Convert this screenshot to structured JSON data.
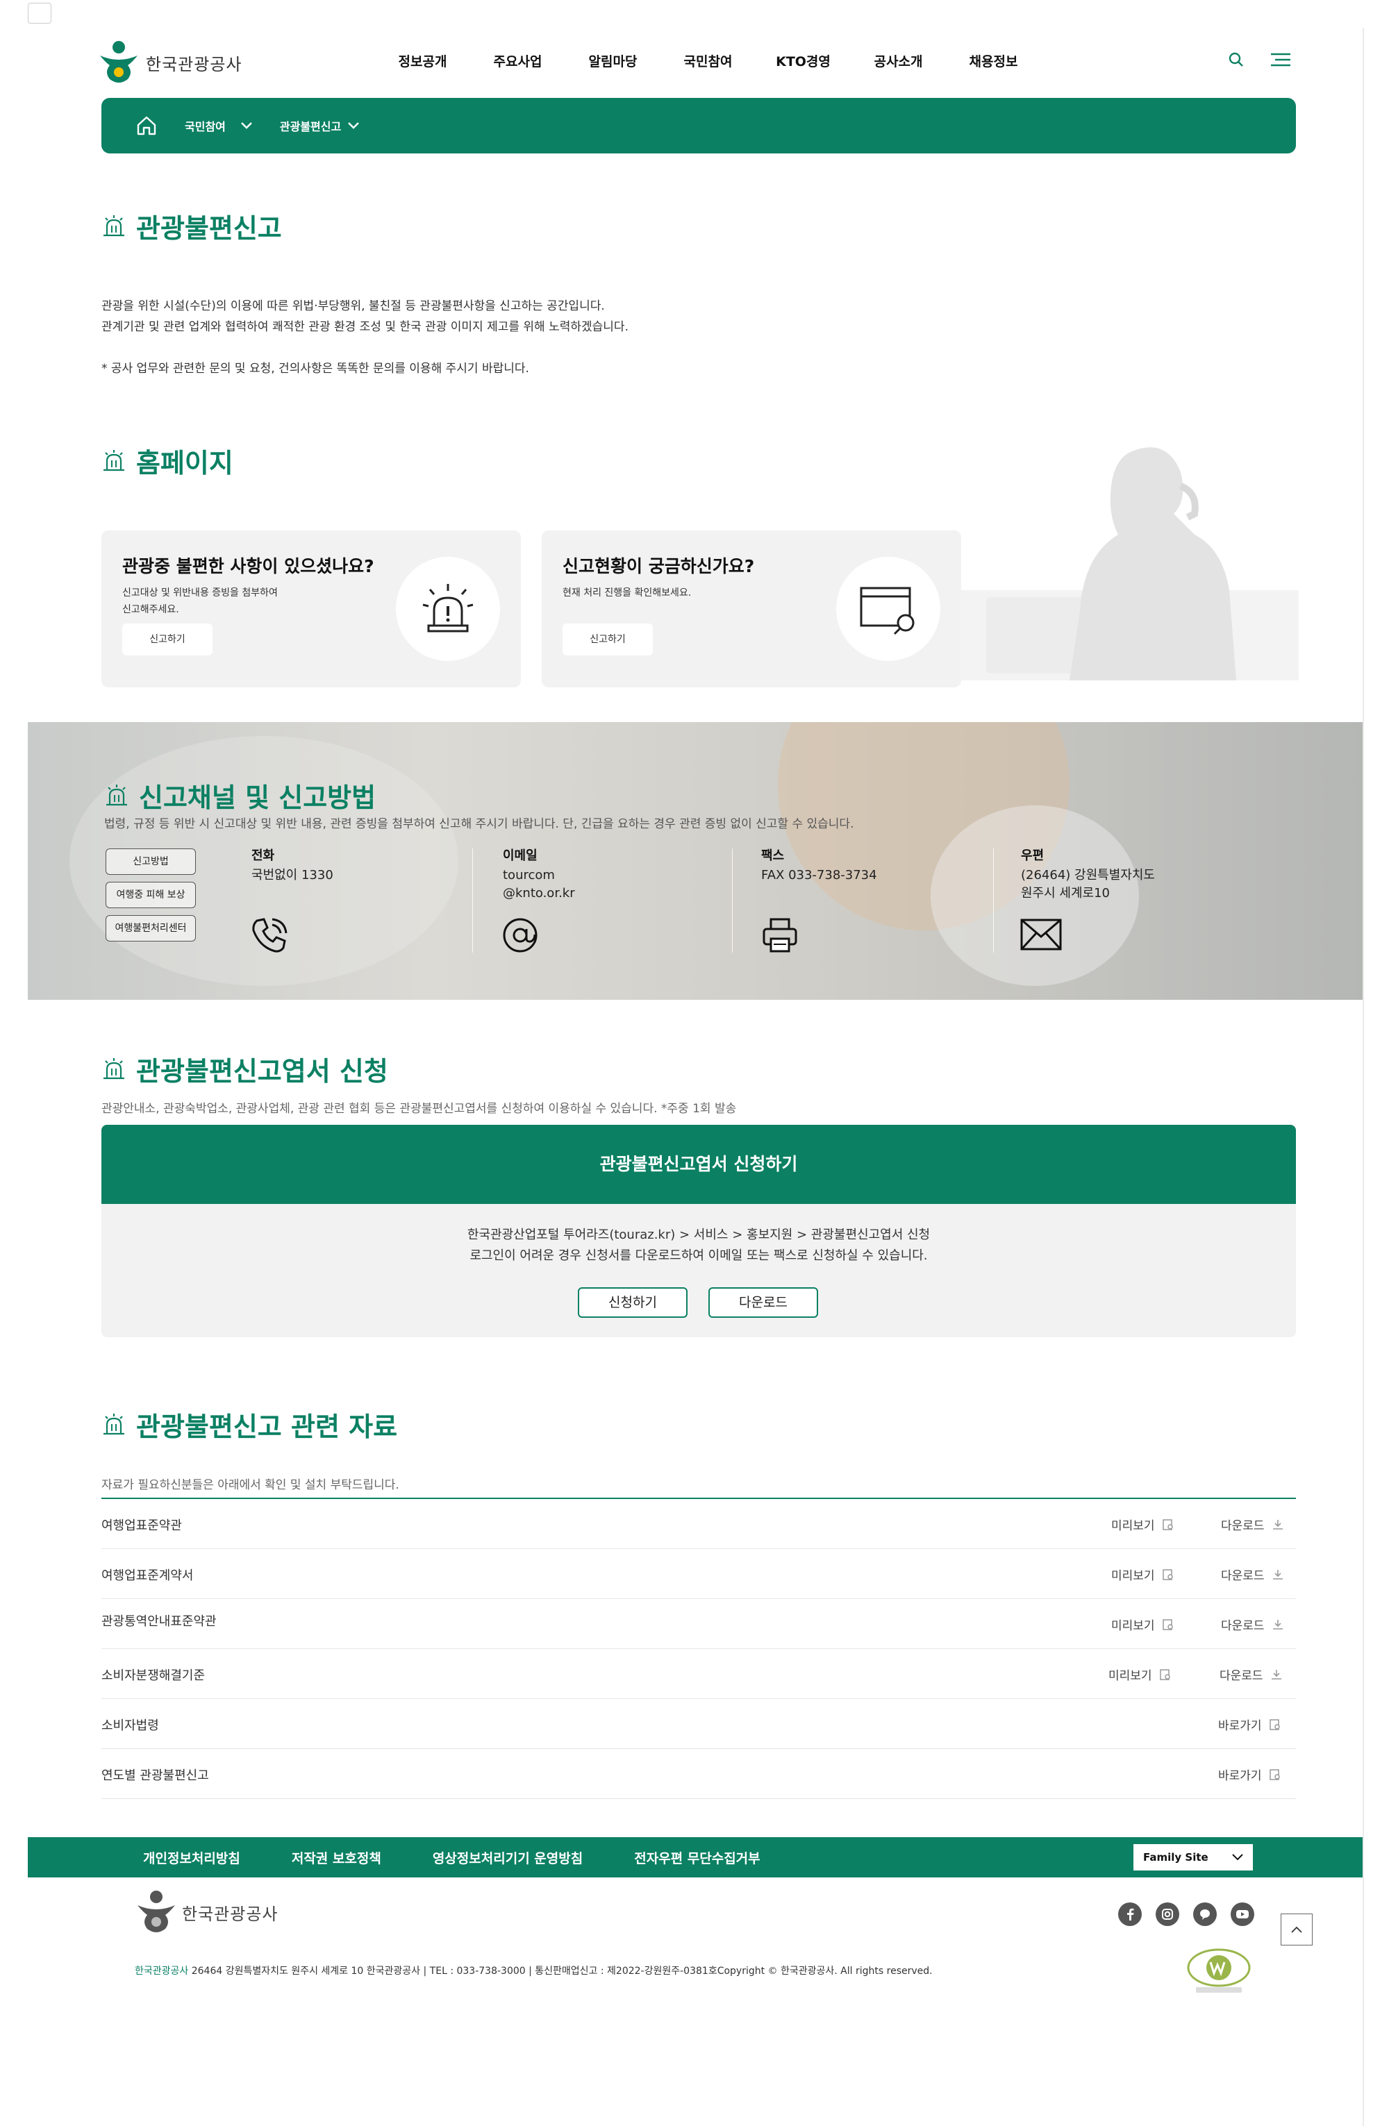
{
  "header": {
    "logo_text": "한국관광공사",
    "nav": [
      "정보공개",
      "주요사업",
      "알림마당",
      "국민참여",
      "KTO경영",
      "공사소개",
      "채용정보"
    ]
  },
  "breadcrumb": {
    "level1": "국민참여",
    "level2": "관광불편신고"
  },
  "intro": {
    "title": "관광불편신고",
    "line1": "관광을 위한 시설(수단)의 이용에 따른 위법·부당행위, 불친절 등 관광불편사항을 신고하는 공간입니다.",
    "line2": "관계기관 및 관련 업계와 협력하여 쾌적한 관광 환경 조성 및 한국 관광 이미지 제고를 위해 노력하겠습니다.",
    "note": "* 공사 업무와 관련한 문의 및 요청, 건의사항은 똑똑한 문의를 이용해 주시기 바랍니다."
  },
  "homepage": {
    "title": "홈페이지",
    "card1": {
      "title": "관광중 불편한 사항이 있으셨나요?",
      "desc_line1": "신고대상 및 위반내용 증빙을 첨부하여",
      "desc_line2": "신고해주세요.",
      "button": "신고하기"
    },
    "card2": {
      "title": "신고현황이 궁금하신가요?",
      "desc_line1": "현재 처리 진행을 확인해보세요.",
      "button": "신고하기"
    }
  },
  "channels": {
    "title": "신고채널 및 신고방법",
    "desc": "법령, 규정 등 위반 시 신고대상 및 위반 내용, 관련 증빙을 첨부하여 신고해 주시기 바랍니다. 단, 긴급을 요하는 경우 관련 증빙 없이 신고할 수 있습니다.",
    "tabs": [
      "신고방법",
      "여행중 피해 보상",
      "여행불편처리센터"
    ],
    "phone": {
      "label": "전화",
      "value": "국번없이 1330"
    },
    "email": {
      "label": "이메일",
      "line1": "tourcom",
      "line2": "@knto.or.kr"
    },
    "fax": {
      "label": "팩스",
      "value": "FAX 033-738-3734"
    },
    "post": {
      "label": "우편",
      "line1": "(26464) 강원특별자치도",
      "line2": "원주시 세계로10"
    }
  },
  "apply": {
    "title": "관광불편신고엽서 신청",
    "desc": "관광안내소, 관광숙박업소, 관광사업체, 관광 관련 협회 등은 관광불편신고엽서를 신청하여 이용하실 수 있습니다. *주중 1회 발송",
    "box_title": "관광불편신고엽서 신청하기",
    "line1": "한국관광산업포털 투어라즈(touraz.kr) > 서비스 > 홍보지원 > 관광불편신고엽서 신청",
    "line2": "로그인이 어려운 경우 신청서를 다운로드하여 이메일 또는 팩스로 신청하실 수 있습니다.",
    "btn_apply": "신청하기",
    "btn_download": "다운로드"
  },
  "resources": {
    "title": "관광불편신고 관련 자료",
    "desc": "자료가 필요하신분들은 아래에서 확인 및 설치 부탁드립니다.",
    "preview": "미리보기",
    "download": "다운로드",
    "goto": "바로가기",
    "items": [
      "여행업표준약관",
      "여행업표준계약서",
      "관광통역안내표준약관",
      "소비자분쟁해결기준",
      "소비자법령",
      "연도별 관광불편신고"
    ]
  },
  "footer": {
    "links": [
      "개인정보처리방침",
      "저작권 보호정책",
      "영상정보처리기기 운영방침",
      "전자우편 무단수집거부"
    ],
    "family_site": "Family Site",
    "logo_text": "한국관광공사",
    "org": "한국관광공사",
    "copyright": " 26464 강원특별자치도 원주시 세계로 10 한국관광공사 | TEL : 033-738-3000 | 통신판매업신고 : 제2022-강원원주-0381호Copyright © 한국관광공사. All rights reserved."
  }
}
